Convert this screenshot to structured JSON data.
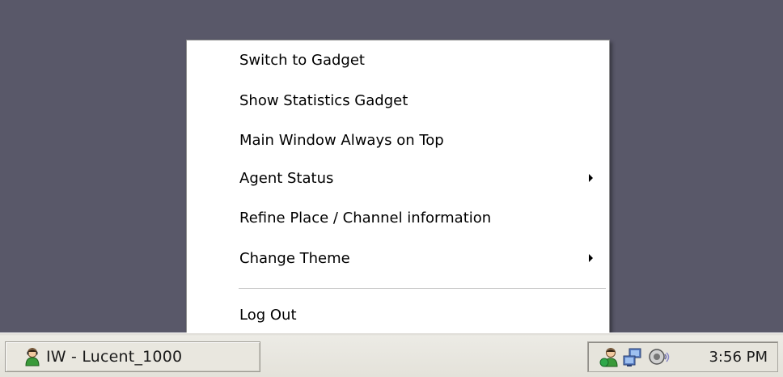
{
  "menu": {
    "items": [
      {
        "label": "Switch to Gadget",
        "has_submenu": false
      },
      {
        "label": "Show Statistics Gadget",
        "has_submenu": false
      },
      {
        "label": "Main Window Always on Top",
        "has_submenu": false
      },
      {
        "label": "Agent Status",
        "has_submenu": true
      },
      {
        "label": "Refine Place / Channel information",
        "has_submenu": false
      },
      {
        "label": "Change Theme",
        "has_submenu": true
      }
    ],
    "logout_label": "Log Out"
  },
  "taskbar": {
    "task_button": {
      "label": "IW - Lucent_1000",
      "icon": "agent-icon"
    },
    "tray": {
      "icons": [
        "agent-status-icon",
        "network-icon",
        "speaker-icon"
      ],
      "clock": "3:56 PM"
    }
  },
  "colors": {
    "desktop": "#595869",
    "menu_background": "#ffffff",
    "taskbar": "#ecebe5",
    "agent_green": "#3a9a3a"
  }
}
